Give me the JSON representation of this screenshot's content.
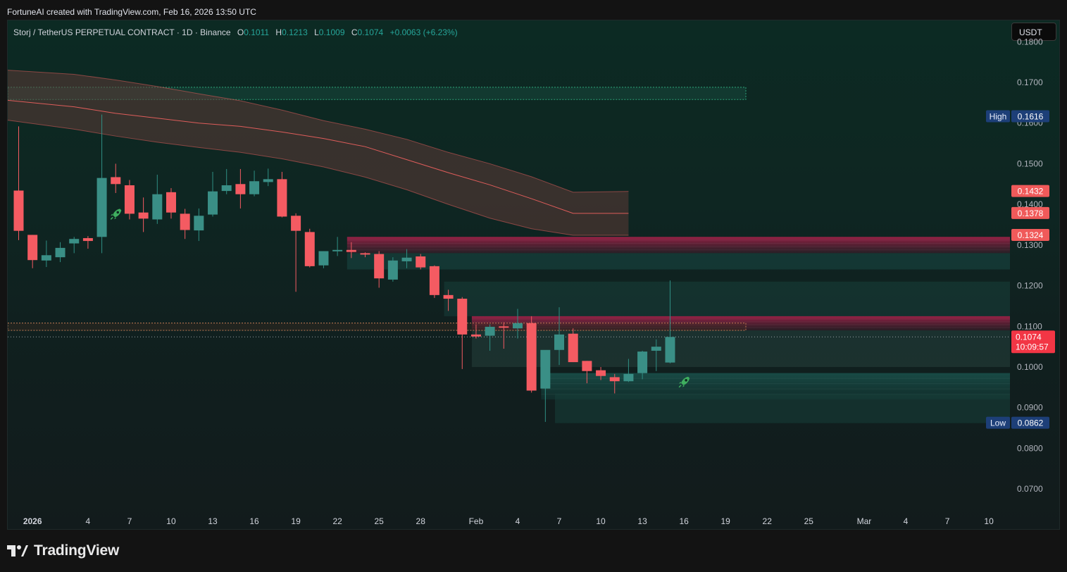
{
  "header": {
    "attribution": "FortuneAI created with TradingView.com, Feb 16, 2026 13:50 UTC"
  },
  "legend": {
    "symbol": "Storj / TetherUS PERPETUAL CONTRACT · 1D · Binance",
    "o_label": "O",
    "o_value": "0.1011",
    "h_label": "H",
    "h_value": "0.1213",
    "l_label": "L",
    "l_value": "0.1009",
    "c_label": "C",
    "c_value": "0.1074",
    "change": "+0.0063 (+6.23%)"
  },
  "currency_button": "USDT",
  "footer": {
    "brand": "TradingView"
  },
  "colors": {
    "up": "#26a69a",
    "down": "#f23645",
    "candle_up_body": "#3a8f86",
    "candle_down_body": "#f45b62",
    "ema_band": "#f0625f",
    "high_badge": "#1d3f78",
    "price_badge": "#f23645"
  },
  "chart_data": {
    "type": "candlestick",
    "title": "Storj / TetherUS PERPETUAL CONTRACT · 1D · Binance",
    "xlabel": "",
    "ylabel": "",
    "ylim": [
      0.065,
      0.182
    ],
    "x_ticks": [
      "2026",
      "4",
      "7",
      "10",
      "13",
      "16",
      "19",
      "22",
      "25",
      "28",
      "Feb",
      "4",
      "7",
      "10",
      "13",
      "16",
      "19",
      "22",
      "25",
      "Mar",
      "4",
      "7",
      "10"
    ],
    "y_ticks": [
      "0.0700",
      "0.0800",
      "0.0900",
      "0.1000",
      "0.1100",
      "0.1200",
      "0.1300",
      "0.1400",
      "0.1500",
      "0.1600",
      "0.1700",
      "0.1800"
    ],
    "grid": false,
    "candles": [
      {
        "date": "2025-12-31",
        "o": 0.1434,
        "h": 0.1592,
        "l": 0.1312,
        "c": 0.1335
      },
      {
        "date": "2026-01-01",
        "o": 0.1325,
        "h": 0.1325,
        "l": 0.1243,
        "c": 0.1263
      },
      {
        "date": "2026-01-02",
        "o": 0.1262,
        "h": 0.1311,
        "l": 0.1246,
        "c": 0.1275
      },
      {
        "date": "2026-01-03",
        "o": 0.127,
        "h": 0.1307,
        "l": 0.1258,
        "c": 0.1293
      },
      {
        "date": "2026-01-04",
        "o": 0.1304,
        "h": 0.132,
        "l": 0.128,
        "c": 0.1315
      },
      {
        "date": "2026-01-05",
        "o": 0.1317,
        "h": 0.1322,
        "l": 0.1291,
        "c": 0.131
      },
      {
        "date": "2026-01-06",
        "o": 0.132,
        "h": 0.1621,
        "l": 0.128,
        "c": 0.1465
      },
      {
        "date": "2026-01-07",
        "o": 0.1467,
        "h": 0.15,
        "l": 0.1428,
        "c": 0.145
      },
      {
        "date": "2026-01-08",
        "o": 0.1447,
        "h": 0.146,
        "l": 0.1363,
        "c": 0.1377
      },
      {
        "date": "2026-01-09",
        "o": 0.138,
        "h": 0.1417,
        "l": 0.1332,
        "c": 0.1365
      },
      {
        "date": "2026-01-10",
        "o": 0.1363,
        "h": 0.1473,
        "l": 0.1352,
        "c": 0.1425
      },
      {
        "date": "2026-01-11",
        "o": 0.143,
        "h": 0.144,
        "l": 0.1365,
        "c": 0.138
      },
      {
        "date": "2026-01-12",
        "o": 0.1377,
        "h": 0.1389,
        "l": 0.1315,
        "c": 0.1337
      },
      {
        "date": "2026-01-13",
        "o": 0.1336,
        "h": 0.139,
        "l": 0.131,
        "c": 0.1372
      },
      {
        "date": "2026-01-14",
        "o": 0.1375,
        "h": 0.148,
        "l": 0.137,
        "c": 0.1432
      },
      {
        "date": "2026-01-15",
        "o": 0.1433,
        "h": 0.1487,
        "l": 0.1425,
        "c": 0.1447
      },
      {
        "date": "2026-01-16",
        "o": 0.145,
        "h": 0.1487,
        "l": 0.139,
        "c": 0.1425
      },
      {
        "date": "2026-01-17",
        "o": 0.1425,
        "h": 0.1483,
        "l": 0.142,
        "c": 0.1457
      },
      {
        "date": "2026-01-18",
        "o": 0.1455,
        "h": 0.1488,
        "l": 0.1445,
        "c": 0.1462
      },
      {
        "date": "2026-01-19",
        "o": 0.1462,
        "h": 0.148,
        "l": 0.1368,
        "c": 0.137
      },
      {
        "date": "2026-01-20",
        "o": 0.1372,
        "h": 0.1378,
        "l": 0.1185,
        "c": 0.1335
      },
      {
        "date": "2026-01-21",
        "o": 0.1332,
        "h": 0.134,
        "l": 0.1245,
        "c": 0.1248
      },
      {
        "date": "2026-01-22",
        "o": 0.125,
        "h": 0.1285,
        "l": 0.1243,
        "c": 0.1285
      },
      {
        "date": "2026-01-23",
        "o": 0.1288,
        "h": 0.132,
        "l": 0.1273,
        "c": 0.1288
      },
      {
        "date": "2026-01-24",
        "o": 0.1288,
        "h": 0.1307,
        "l": 0.1268,
        "c": 0.1283
      },
      {
        "date": "2026-01-25",
        "o": 0.128,
        "h": 0.1282,
        "l": 0.127,
        "c": 0.1279
      },
      {
        "date": "2026-01-26",
        "o": 0.1278,
        "h": 0.1285,
        "l": 0.1195,
        "c": 0.1218
      },
      {
        "date": "2026-01-27",
        "o": 0.1215,
        "h": 0.127,
        "l": 0.121,
        "c": 0.1262
      },
      {
        "date": "2026-01-28",
        "o": 0.126,
        "h": 0.129,
        "l": 0.1243,
        "c": 0.1269
      },
      {
        "date": "2026-01-29",
        "o": 0.1272,
        "h": 0.1278,
        "l": 0.124,
        "c": 0.1245
      },
      {
        "date": "2026-01-30",
        "o": 0.1248,
        "h": 0.125,
        "l": 0.117,
        "c": 0.1177
      },
      {
        "date": "2026-01-31",
        "o": 0.1177,
        "h": 0.119,
        "l": 0.1138,
        "c": 0.1168
      },
      {
        "date": "2026-02-01",
        "o": 0.1168,
        "h": 0.1172,
        "l": 0.0995,
        "c": 0.108
      },
      {
        "date": "2026-02-02",
        "o": 0.108,
        "h": 0.1105,
        "l": 0.107,
        "c": 0.1075
      },
      {
        "date": "2026-02-03",
        "o": 0.1077,
        "h": 0.1105,
        "l": 0.104,
        "c": 0.1099
      },
      {
        "date": "2026-02-04",
        "o": 0.11,
        "h": 0.111,
        "l": 0.1045,
        "c": 0.1098
      },
      {
        "date": "2026-02-05",
        "o": 0.1095,
        "h": 0.1143,
        "l": 0.107,
        "c": 0.1108
      },
      {
        "date": "2026-02-06",
        "o": 0.1108,
        "h": 0.1125,
        "l": 0.0937,
        "c": 0.0942
      },
      {
        "date": "2026-02-07",
        "o": 0.0947,
        "h": 0.1039,
        "l": 0.0865,
        "c": 0.1042
      },
      {
        "date": "2026-02-08",
        "o": 0.1042,
        "h": 0.1147,
        "l": 0.1005,
        "c": 0.108
      },
      {
        "date": "2026-02-09",
        "o": 0.1082,
        "h": 0.1095,
        "l": 0.1012,
        "c": 0.1012
      },
      {
        "date": "2026-02-10",
        "o": 0.1015,
        "h": 0.1015,
        "l": 0.096,
        "c": 0.099
      },
      {
        "date": "2026-02-11",
        "o": 0.0992,
        "h": 0.1,
        "l": 0.0968,
        "c": 0.0978
      },
      {
        "date": "2026-02-12",
        "o": 0.0975,
        "h": 0.0983,
        "l": 0.0935,
        "c": 0.0965
      },
      {
        "date": "2026-02-13",
        "o": 0.0965,
        "h": 0.102,
        "l": 0.0963,
        "c": 0.0983
      },
      {
        "date": "2026-02-14",
        "o": 0.0985,
        "h": 0.104,
        "l": 0.097,
        "c": 0.1038
      },
      {
        "date": "2026-02-15",
        "o": 0.104,
        "h": 0.1068,
        "l": 0.099,
        "c": 0.105
      },
      {
        "date": "2026-02-16",
        "o": 0.1011,
        "h": 0.1213,
        "l": 0.1009,
        "c": 0.1074
      }
    ],
    "ema_band": {
      "name": "",
      "upper": [
        [
          0,
          0.173
        ],
        [
          4,
          0.172
        ],
        [
          7,
          0.1706
        ],
        [
          10,
          0.169
        ],
        [
          13,
          0.1672
        ],
        [
          16,
          0.1655
        ],
        [
          19,
          0.1632
        ],
        [
          22,
          0.1606
        ],
        [
          25,
          0.1585
        ],
        [
          28,
          0.156
        ],
        [
          31,
          0.1528
        ],
        [
          34,
          0.15
        ],
        [
          37,
          0.1468
        ],
        [
          40,
          0.143
        ],
        [
          44,
          0.1432
        ]
      ],
      "mid": [
        [
          0,
          0.1656
        ],
        [
          4,
          0.164
        ],
        [
          7,
          0.1624
        ],
        [
          10,
          0.1612
        ],
        [
          13,
          0.16
        ],
        [
          16,
          0.1592
        ],
        [
          19,
          0.1578
        ],
        [
          22,
          0.1562
        ],
        [
          25,
          0.1542
        ],
        [
          28,
          0.151
        ],
        [
          31,
          0.1478
        ],
        [
          34,
          0.1448
        ],
        [
          37,
          0.1414
        ],
        [
          40,
          0.1378
        ],
        [
          44,
          0.1378
        ]
      ],
      "lower": [
        [
          0,
          0.1607
        ],
        [
          4,
          0.1585
        ],
        [
          7,
          0.1568
        ],
        [
          10,
          0.1553
        ],
        [
          13,
          0.154
        ],
        [
          16,
          0.1528
        ],
        [
          19,
          0.1512
        ],
        [
          22,
          0.1492
        ],
        [
          25,
          0.1467
        ],
        [
          28,
          0.1436
        ],
        [
          31,
          0.14
        ],
        [
          34,
          0.1366
        ],
        [
          37,
          0.134
        ],
        [
          40,
          0.1324
        ],
        [
          44,
          0.1324
        ]
      ]
    },
    "zones": [
      {
        "kind": "supply",
        "y0": 0.128,
        "y1": 0.132,
        "start": 24,
        "end": "right",
        "color": "#a51f45"
      },
      {
        "kind": "supply",
        "y0": 0.109,
        "y1": 0.1125,
        "start": 33,
        "end": "right",
        "color": "#a51f45"
      },
      {
        "kind": "demand",
        "y0": 0.092,
        "y1": 0.0985,
        "start": 38,
        "end": "right",
        "color": "#1f6f66"
      }
    ],
    "marker_icons": [
      {
        "index": 7,
        "price": 0.1377,
        "icon": "rocket-icon"
      },
      {
        "index": 48,
        "price": 0.0964,
        "icon": "rocket-icon"
      }
    ],
    "price_labels": [
      {
        "label": "High",
        "value": "0.1616",
        "price": 0.1616,
        "kind": "high"
      },
      {
        "label": "",
        "value": "0.1432",
        "price": 0.1432,
        "kind": "band"
      },
      {
        "label": "",
        "value": "0.1378",
        "price": 0.1378,
        "kind": "band"
      },
      {
        "label": "",
        "value": "0.1324",
        "price": 0.1324,
        "kind": "band"
      },
      {
        "label": "",
        "value": "0.1074",
        "price": 0.1074,
        "kind": "last",
        "sub": "10:09:57"
      },
      {
        "label": "Low",
        "value": "0.0862",
        "price": 0.0862,
        "kind": "low"
      }
    ]
  }
}
